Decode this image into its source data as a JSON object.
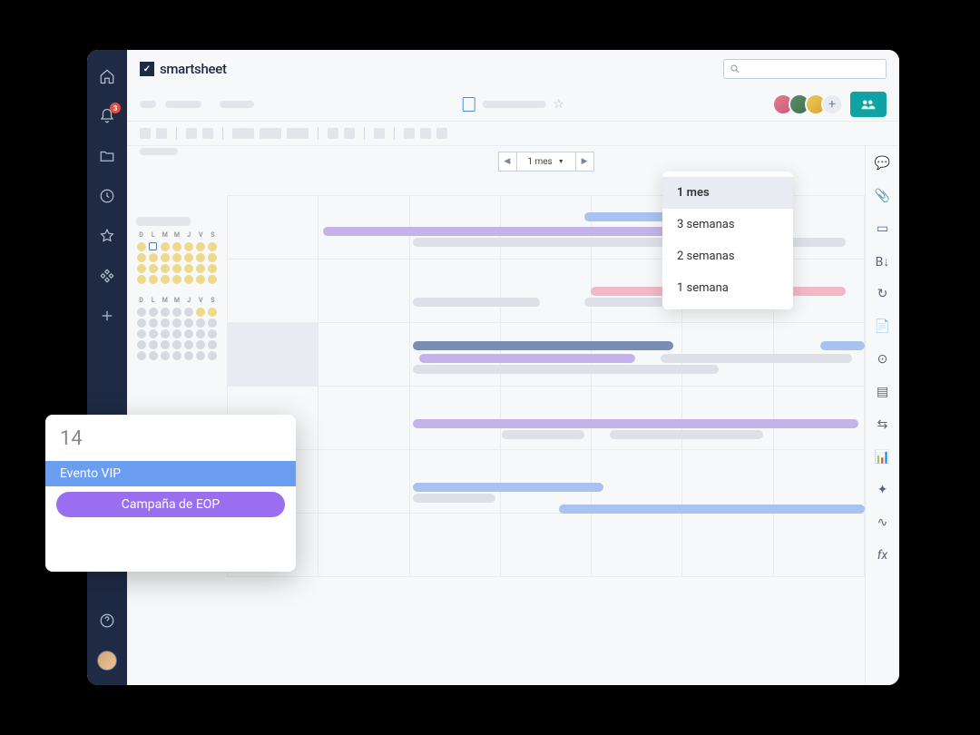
{
  "app": {
    "logo_text": "smartsheet"
  },
  "notifications": {
    "count": "3"
  },
  "range_picker": {
    "value": "1 mes"
  },
  "dropdown": {
    "options": [
      {
        "label": "1 mes",
        "selected": true
      },
      {
        "label": "3 semanas",
        "selected": false
      },
      {
        "label": "2 semanas",
        "selected": false
      },
      {
        "label": "1 semana",
        "selected": false
      }
    ]
  },
  "minical": {
    "day_headers": [
      "D",
      "L",
      "M",
      "M",
      "J",
      "V",
      "S"
    ]
  },
  "popover": {
    "day": "14",
    "events": [
      {
        "label": "Evento VIP",
        "color": "blue"
      },
      {
        "label": "Campaña de EOP",
        "color": "purple"
      }
    ]
  },
  "colors": {
    "brand_navy": "#1f2a44",
    "teal_share": "#0fa3a3",
    "event_blue": "#6b9df0",
    "event_purple": "#9b6ef0"
  }
}
